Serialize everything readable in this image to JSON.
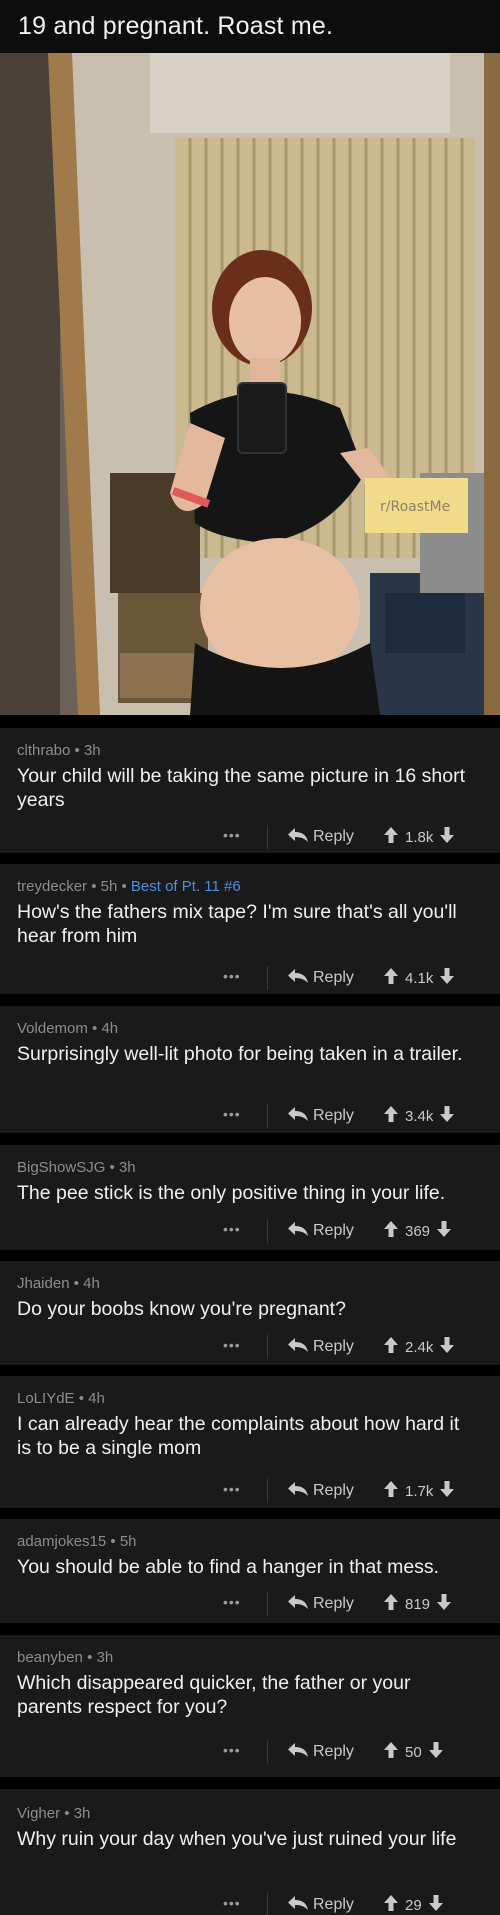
{
  "post": {
    "title": "19 and pregnant. Roast me.",
    "sign_text": "r/RoastMe"
  },
  "actions": {
    "more_label": "•••",
    "reply_label": "Reply"
  },
  "comments": [
    {
      "author": "clthrabo",
      "age": "3h",
      "flair": "",
      "text": "Your child will be taking the same picture in 16 short years",
      "score": "1.8k"
    },
    {
      "author": "treydecker",
      "age": "5h",
      "flair": "Best of Pt. 11 #6",
      "text": "How's the fathers mix tape? I'm sure that's all you'll hear from him",
      "score": "4.1k"
    },
    {
      "author": "Voldemom",
      "age": "4h",
      "flair": "",
      "text": "Surprisingly well-lit photo for being taken in a trailer.",
      "score": "3.4k"
    },
    {
      "author": "BigShowSJG",
      "age": "3h",
      "flair": "",
      "text": "The pee stick is the only positive thing in your life.",
      "score": "369"
    },
    {
      "author": "Jhaiden",
      "age": "4h",
      "flair": "",
      "text": "Do your boobs know you're pregnant?",
      "score": "2.4k"
    },
    {
      "author": "LoLIYdE",
      "age": "4h",
      "flair": "",
      "text": "I can already hear the complaints about how hard it is to be a single mom",
      "score": "1.7k"
    },
    {
      "author": "adamjokes15",
      "age": "5h",
      "flair": "",
      "text": "You should be able to find a hanger in that mess.",
      "score": "819"
    },
    {
      "author": "beanyben",
      "age": "3h",
      "flair": "",
      "text": "Which disappeared quicker, the father or your parents respect for you?",
      "score": "50"
    },
    {
      "author": "Vigher",
      "age": "3h",
      "flair": "",
      "text": "Why ruin your day when you've just ruined your life",
      "score": "29"
    }
  ]
}
